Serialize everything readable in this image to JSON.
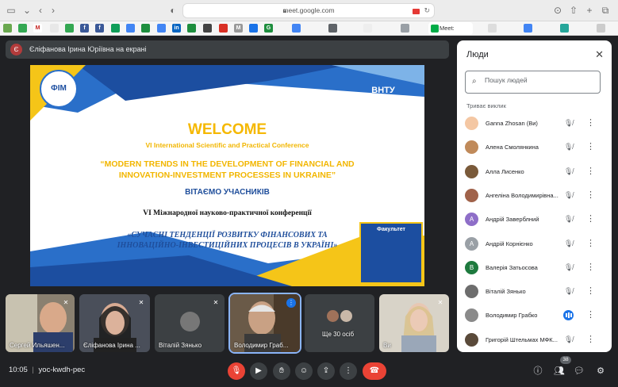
{
  "browser": {
    "url": "meet.google.com",
    "active_tab_label": "Meet: "
  },
  "presenter": {
    "initial": "Є",
    "label": "Єліфанова Ірина Юріївна на екрані"
  },
  "slide": {
    "logo_left": "ФІМ",
    "logo_right": "ВНТУ",
    "badge_label": "Факультет",
    "welcome": "WELCOME",
    "conference_en": "VI International Scientific and Practical Conference",
    "title_en_line1": "“MODERN TRENDS IN THE DEVELOPMENT OF FINANCIAL AND",
    "title_en_line2": "INNOVATION-INVESTMENT PROCESSES IN UKRAINE”",
    "greeting_uk": "ВІТАЄМО УЧАСНИКІВ",
    "conference_uk": "VI Міжнародної науково-практичної конференції",
    "title_uk_line1": "«СУЧАСНІ ТЕНДЕНЦІЇ РОЗВИТКУ ФІНАНСОВИХ ТА",
    "title_uk_line2": "ІННОВАЦІЙНО-ІНВЕСТИЦІЙНИХ ПРОЦЕСІВ В УКРАЇНІ»"
  },
  "tiles": [
    {
      "name": "Сергей Ильяшен..."
    },
    {
      "name": "Єліфанова Ірина ..."
    },
    {
      "name": "Віталій Зянько"
    },
    {
      "name": "Володимир Граб..."
    },
    {
      "name": "Ще 30 осіб"
    },
    {
      "name": "Ви"
    }
  ],
  "bottom_bar": {
    "time": "10:05",
    "separator": "|",
    "meeting_code": "yoc-kwdh-pec",
    "people_count": "38"
  },
  "people_panel": {
    "title": "Люди",
    "search_placeholder": "Пошук людей",
    "section_label": "Триває виклик",
    "people": [
      {
        "name": "Ganna Zhosan (Ви)",
        "initial": "",
        "color": "#f4c7a3"
      },
      {
        "name": "Алена Смолянкина",
        "initial": "",
        "color": "#c08a5a"
      },
      {
        "name": "Алла Лисенко",
        "initial": "",
        "color": "#7a5a3a"
      },
      {
        "name": "Ангеліна Володимирівна...",
        "initial": "",
        "color": "#a0624a"
      },
      {
        "name": "Андрій Заверблний",
        "initial": "А",
        "color": "#8e6ec8"
      },
      {
        "name": "Андрій Корнієнко",
        "initial": "А",
        "color": "#9aa0a6"
      },
      {
        "name": "Валерія Затьосова",
        "initial": "В",
        "color": "#1e7a3e"
      },
      {
        "name": "Віталій Зянько",
        "initial": "",
        "color": "#6d6d6d"
      },
      {
        "name": "Володимир Грабко",
        "initial": "",
        "color": "#8a8a8a"
      },
      {
        "name": "Григорій Штельмах МФК...",
        "initial": "",
        "color": "#5a4a3a"
      }
    ]
  }
}
